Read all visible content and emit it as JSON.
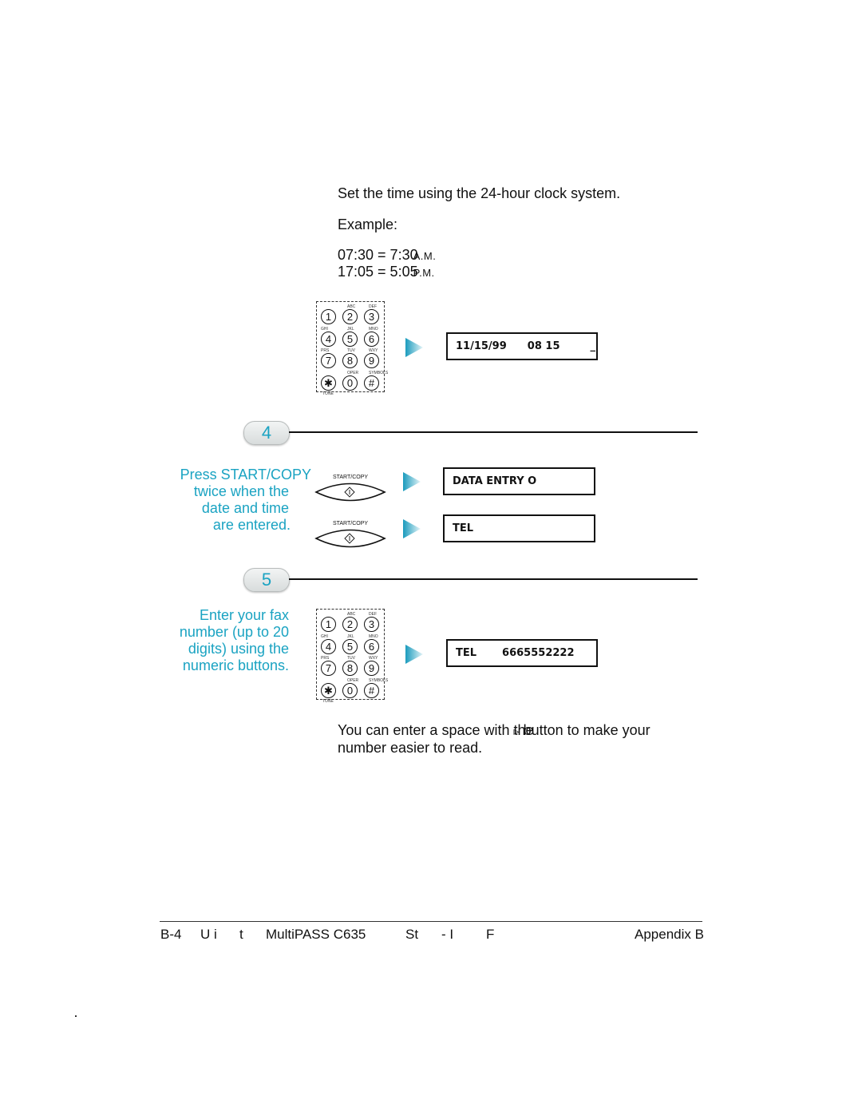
{
  "intro": {
    "instruction": "Set the time using the 24-hour clock system.",
    "example_label": "Example:",
    "examples": [
      {
        "value": "07:30 = 7:30",
        "suffix": "A.M."
      },
      {
        "value": "17:05 = 5:05",
        "suffix": "P.M."
      }
    ]
  },
  "keypad": {
    "keys": [
      {
        "digit": "1",
        "letters": ""
      },
      {
        "digit": "2",
        "letters": "ABC"
      },
      {
        "digit": "3",
        "letters": "DEF"
      },
      {
        "digit": "4",
        "letters": "GHI"
      },
      {
        "digit": "5",
        "letters": "JKL"
      },
      {
        "digit": "6",
        "letters": "MNO"
      },
      {
        "digit": "7",
        "letters": "PRS"
      },
      {
        "digit": "8",
        "letters": "TUV"
      },
      {
        "digit": "9",
        "letters": "WXY"
      },
      {
        "digit": "✱",
        "letters": "TONE"
      },
      {
        "digit": "0",
        "letters": "OPER"
      },
      {
        "digit": "#",
        "letters": "SYMBOLS"
      }
    ]
  },
  "displays": {
    "datetime": {
      "date": "11/15/99",
      "time": "08 15",
      "cursor": "_"
    },
    "data_entry": "DATA ENTRY O",
    "tel_empty": "TEL",
    "tel_filled": {
      "label": "TEL",
      "number": "6665552222"
    }
  },
  "steps": [
    {
      "number": "4",
      "instruction_lines": [
        "Press START/COPY",
        "twice when the",
        "date and time",
        "are entered."
      ],
      "button_label": "START/COPY"
    },
    {
      "number": "5",
      "instruction_lines": [
        "Enter your fax",
        "number (up to 20",
        "digits) using the",
        "numeric buttons."
      ]
    }
  ],
  "note": {
    "line1_a": "You can enter a space with the",
    "line1_overlay": "▹",
    "line1_b": "button to make your",
    "line2": "number easier to read."
  },
  "footer": {
    "page": "B-4",
    "parts": [
      "U i",
      "t",
      "MultiPASS C635",
      "St",
      "- I",
      "F"
    ],
    "section": "Appendix B"
  },
  "colors": {
    "accent": "#1aa3c2",
    "text": "#111111"
  }
}
